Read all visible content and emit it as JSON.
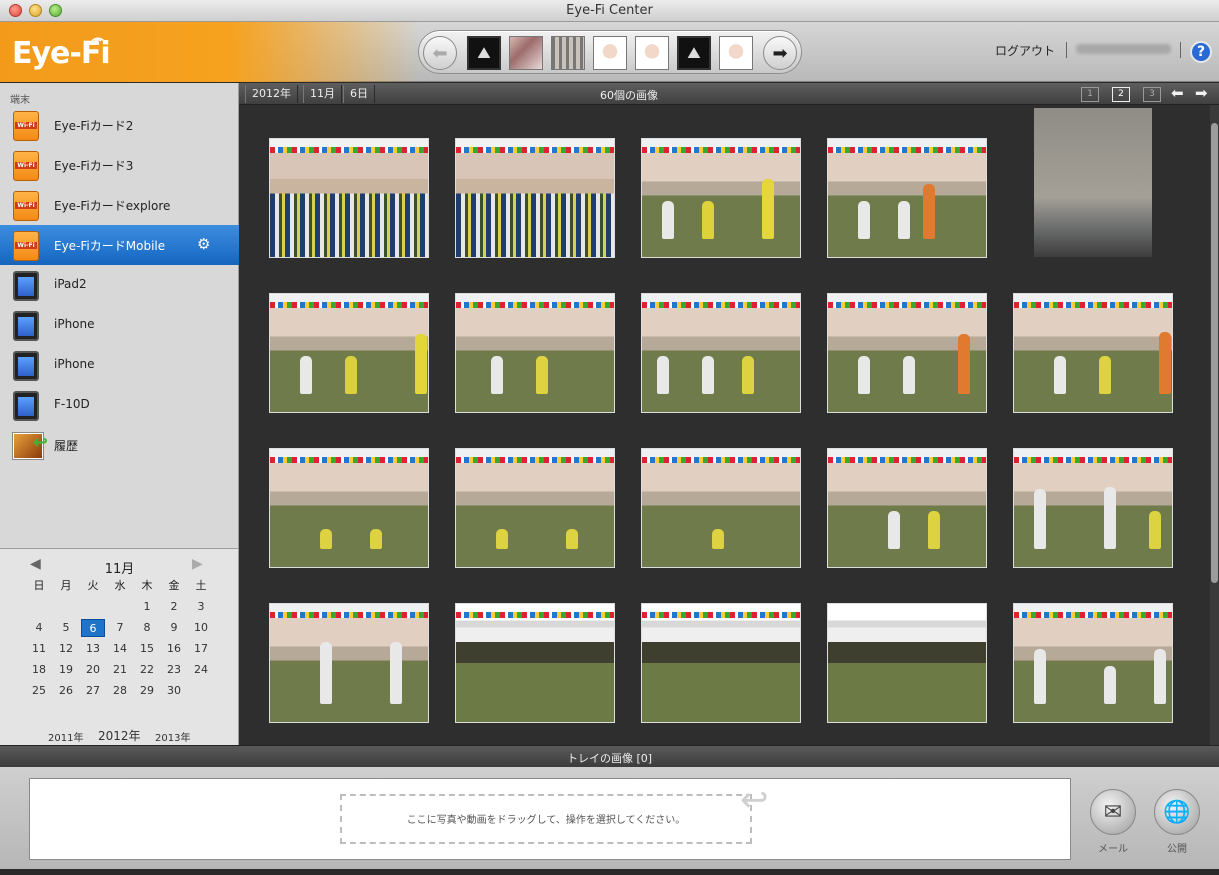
{
  "window": {
    "title": "Eye-Fi Center"
  },
  "header": {
    "logo": "Eye-Fi",
    "logout": "ログアウト",
    "help": "?"
  },
  "sidebar": {
    "heading": "端末",
    "devices": [
      {
        "label": "Eye-Fiカード2",
        "icon": "sd-card-icon",
        "selected": false
      },
      {
        "label": "Eye-Fiカード3",
        "icon": "sd-card-icon",
        "selected": false
      },
      {
        "label": "Eye-Fiカードexplore",
        "icon": "sd-card-icon",
        "selected": false
      },
      {
        "label": "Eye-FiカードMobile",
        "icon": "sd-card-icon",
        "selected": true
      },
      {
        "label": "iPad2",
        "icon": "tablet-icon",
        "selected": false
      },
      {
        "label": "iPhone",
        "icon": "phone-icon",
        "selected": false
      },
      {
        "label": "iPhone",
        "icon": "phone-icon",
        "selected": false
      },
      {
        "label": "F-10D",
        "icon": "phone-icon",
        "selected": false
      },
      {
        "label": "履歴",
        "icon": "history-icon",
        "selected": false
      }
    ]
  },
  "calendar": {
    "month": "11月",
    "weekdays": [
      "日",
      "月",
      "火",
      "水",
      "木",
      "金",
      "土"
    ],
    "weeks": [
      [
        "",
        "",
        "",
        "",
        "1",
        "2",
        "3"
      ],
      [
        "4",
        "5",
        "6",
        "7",
        "8",
        "9",
        "10"
      ],
      [
        "11",
        "12",
        "13",
        "14",
        "15",
        "16",
        "17"
      ],
      [
        "18",
        "19",
        "20",
        "21",
        "22",
        "23",
        "24"
      ],
      [
        "25",
        "26",
        "27",
        "28",
        "29",
        "30",
        ""
      ]
    ],
    "selected_day": "6",
    "years": {
      "prev": "2011年",
      "current": "2012年",
      "next": "2013年"
    }
  },
  "toolbar": {
    "breadcrumbs": [
      "2012年",
      "11月",
      "6日"
    ],
    "image_count": "60個の画像",
    "pages": [
      "1",
      "2",
      "3"
    ],
    "current_page": "2"
  },
  "tray": {
    "title": "トレイの画像 [0]",
    "drop_hint": "ここに写真や動画をドラッグして、操作を選択してください。",
    "actions": [
      {
        "label": "メール",
        "icon": "mail-icon"
      },
      {
        "label": "公開",
        "icon": "globe-icon"
      }
    ]
  },
  "colors": {
    "brand_orange": "#f39a1b",
    "selection_blue": "#1e74c8",
    "grid_background": "#2e2e2e"
  }
}
